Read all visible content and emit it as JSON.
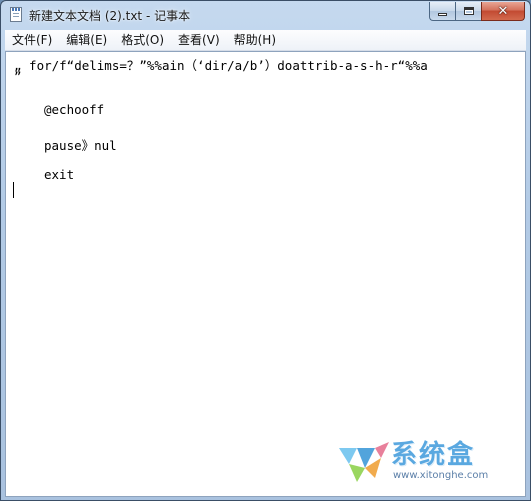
{
  "window": {
    "title": "新建文本文档 (2).txt - 记事本",
    "app_icon": "notepad-icon"
  },
  "menu": {
    "items": [
      {
        "label": "文件(F)"
      },
      {
        "label": "编辑(E)"
      },
      {
        "label": "格式(O)"
      },
      {
        "label": "查看(V)"
      },
      {
        "label": "帮助(H)"
      }
    ]
  },
  "document": {
    "lines": [
      "„ for/f“delims=？”%%ain（‘dir/a/b’）doattrib-a-s-h-r“%%a",
      "”",
      "@echooff",
      "pause》nul",
      "exit"
    ]
  },
  "watermark": {
    "brand": "系统盒",
    "url": "www.xitonghe.com"
  },
  "colors": {
    "close_button": "#c24a32",
    "watermark_blue": "#5aa8e0"
  }
}
